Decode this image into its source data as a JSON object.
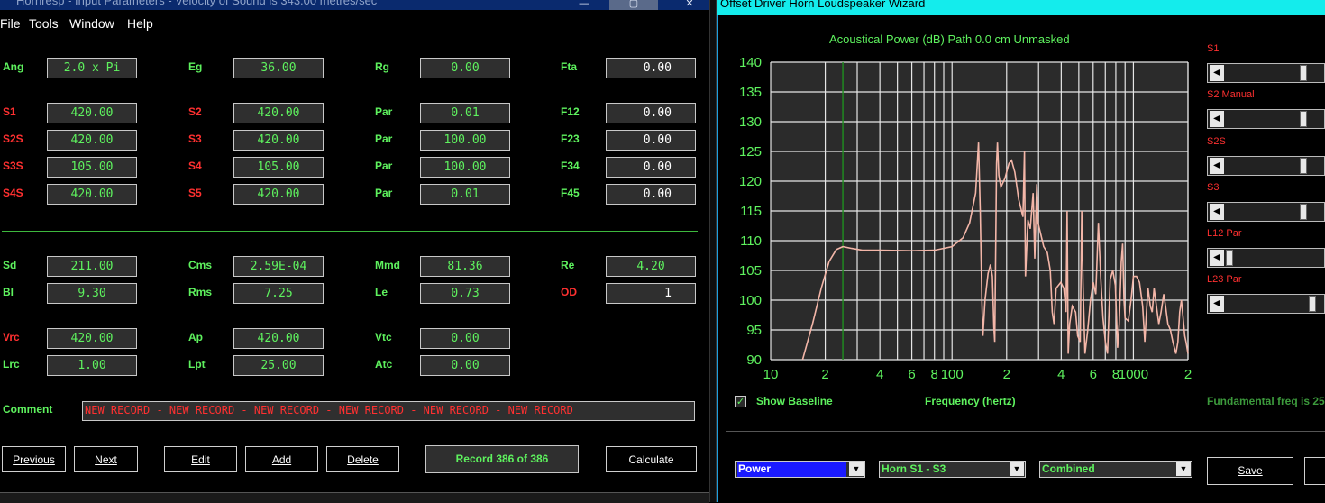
{
  "left_window": {
    "title": "Hornresp - Input Parameters - Velocity of Sound is 343.00 metres/sec",
    "controls": [
      "—",
      "▢",
      "✕"
    ],
    "menu": [
      "File",
      "Tools",
      "Window",
      "Help"
    ],
    "params": [
      {
        "key": "ang",
        "label": "Ang",
        "value": "2.0 x Pi",
        "red": false
      },
      {
        "key": "eg",
        "label": "Eg",
        "value": "36.00",
        "red": false
      },
      {
        "key": "rg",
        "label": "Rg",
        "value": "0.00",
        "red": false
      },
      {
        "key": "fta",
        "label": "Fta",
        "value": "0.00",
        "red": false,
        "white": true
      },
      {
        "key": "s1",
        "label": "S1",
        "value": "420.00",
        "red": true
      },
      {
        "key": "s2",
        "label": "S2",
        "value": "420.00",
        "red": true
      },
      {
        "key": "par1",
        "label": "Par",
        "value": "0.01",
        "red": false
      },
      {
        "key": "f12",
        "label": "F12",
        "value": "0.00",
        "red": false,
        "white": true
      },
      {
        "key": "s2s",
        "label": "S2S",
        "value": "420.00",
        "red": true
      },
      {
        "key": "s3",
        "label": "S3",
        "value": "420.00",
        "red": true
      },
      {
        "key": "par2",
        "label": "Par",
        "value": "100.00",
        "red": false
      },
      {
        "key": "f23",
        "label": "F23",
        "value": "0.00",
        "red": false,
        "white": true
      },
      {
        "key": "s3s",
        "label": "S3S",
        "value": "105.00",
        "red": true
      },
      {
        "key": "s4",
        "label": "S4",
        "value": "105.00",
        "red": true
      },
      {
        "key": "par3",
        "label": "Par",
        "value": "100.00",
        "red": false
      },
      {
        "key": "f34",
        "label": "F34",
        "value": "0.00",
        "red": false,
        "white": true
      },
      {
        "key": "s4s",
        "label": "S4S",
        "value": "420.00",
        "red": true
      },
      {
        "key": "s5",
        "label": "S5",
        "value": "420.00",
        "red": true
      },
      {
        "key": "par4",
        "label": "Par",
        "value": "0.01",
        "red": false
      },
      {
        "key": "f45",
        "label": "F45",
        "value": "0.00",
        "red": false,
        "white": true
      },
      {
        "key": "sd",
        "label": "Sd",
        "value": "211.00",
        "red": false
      },
      {
        "key": "cms",
        "label": "Cms",
        "value": "2.59E-04",
        "red": false
      },
      {
        "key": "mmd",
        "label": "Mmd",
        "value": "81.36",
        "red": false
      },
      {
        "key": "re",
        "label": "Re",
        "value": "4.20",
        "red": false
      },
      {
        "key": "bl",
        "label": "Bl",
        "value": "9.30",
        "red": false
      },
      {
        "key": "rms",
        "label": "Rms",
        "value": "7.25",
        "red": false
      },
      {
        "key": "le",
        "label": "Le",
        "value": "0.73",
        "red": false
      },
      {
        "key": "od",
        "label": "OD",
        "value": "1",
        "red": true,
        "white": true
      },
      {
        "key": "vrc",
        "label": "Vrc",
        "value": "420.00",
        "red": true
      },
      {
        "key": "ap",
        "label": "Ap",
        "value": "420.00",
        "red": false
      },
      {
        "key": "vtc",
        "label": "Vtc",
        "value": "0.00",
        "red": false
      },
      {
        "key": "lrc",
        "label": "Lrc",
        "value": "1.00",
        "red": false
      },
      {
        "key": "lpt",
        "label": "Lpt",
        "value": "25.00",
        "red": false
      },
      {
        "key": "atc",
        "label": "Atc",
        "value": "0.00",
        "red": false
      }
    ],
    "comment_label": "Comment",
    "comment_value": "NEW RECORD - NEW RECORD - NEW RECORD - NEW RECORD - NEW RECORD - NEW RECORD",
    "buttons": {
      "previous": "Previous",
      "next": "Next",
      "edit": "Edit",
      "add": "Add",
      "delete": "Delete",
      "calculate": "Calculate"
    },
    "record": "Record 386 of 386"
  },
  "right_window": {
    "title": "Offset Driver Horn Loudspeaker Wizard",
    "sliders": [
      {
        "label": "S1",
        "position": 0.82
      },
      {
        "label": "S2 Manual",
        "position": 0.82
      },
      {
        "label": "S2S",
        "position": 0.82
      },
      {
        "label": "S3",
        "position": 0.82
      },
      {
        "label": "L12 Par",
        "position": 0.0
      },
      {
        "label": "L23 Par",
        "position": 0.92
      }
    ],
    "show_baseline": "Show Baseline",
    "show_baseline_checked": true,
    "fundamental": "Fundamental freq is 25",
    "combos": {
      "view": "Power",
      "segment": "Horn S1 - S3",
      "mode": "Combined"
    },
    "save": "Save"
  },
  "chart_data": {
    "type": "line",
    "title": "Acoustical Power (dB)   Path 0.0 cm   Unmasked",
    "xlabel": "Frequency (hertz)",
    "ylabel": "",
    "x_scale": "log",
    "xlim": [
      10,
      2000
    ],
    "ylim": [
      90,
      140
    ],
    "y_ticks": [
      140,
      135,
      130,
      125,
      120,
      115,
      110,
      105,
      100,
      95,
      90
    ],
    "x_ticks": [
      {
        "v": 10,
        "t": "10"
      },
      {
        "v": 20,
        "t": "2"
      },
      {
        "v": 40,
        "t": "4"
      },
      {
        "v": 60,
        "t": "6"
      },
      {
        "v": 80,
        "t": "8"
      },
      {
        "v": 100,
        "t": "100"
      },
      {
        "v": 200,
        "t": "2"
      },
      {
        "v": 400,
        "t": "4"
      },
      {
        "v": 600,
        "t": "6"
      },
      {
        "v": 800,
        "t": "8"
      },
      {
        "v": 1000,
        "t": "1000"
      },
      {
        "v": 2000,
        "t": "2"
      }
    ],
    "marker_x": 25,
    "grid": true,
    "series": [
      {
        "color": "#f3b6a8",
        "points": [
          [
            15,
            90
          ],
          [
            17,
            96
          ],
          [
            19,
            102
          ],
          [
            21,
            106.5
          ],
          [
            23,
            108.5
          ],
          [
            25,
            109
          ],
          [
            28,
            108.7
          ],
          [
            32,
            108.4
          ],
          [
            40,
            108.4
          ],
          [
            60,
            108.3
          ],
          [
            80,
            108.4
          ],
          [
            100,
            109
          ],
          [
            115,
            110.5
          ],
          [
            125,
            113
          ],
          [
            135,
            118
          ],
          [
            140,
            126.5
          ],
          [
            143,
            115
          ],
          [
            146,
            100
          ],
          [
            148,
            94
          ],
          [
            152,
            100
          ],
          [
            158,
            104.5
          ],
          [
            163,
            106
          ],
          [
            167,
            104
          ],
          [
            170,
            95.5
          ],
          [
            172,
            93
          ],
          [
            176,
            123
          ],
          [
            178,
            126.5
          ],
          [
            181,
            121
          ],
          [
            186,
            119
          ],
          [
            196,
            120.5
          ],
          [
            206,
            123
          ],
          [
            213,
            123.5
          ],
          [
            222,
            121.5
          ],
          [
            233,
            117
          ],
          [
            246,
            114
          ],
          [
            251,
            125
          ],
          [
            254,
            104
          ],
          [
            262,
            113.5
          ],
          [
            270,
            112
          ],
          [
            280,
            118
          ],
          [
            286,
            107
          ],
          [
            293,
            119.5
          ],
          [
            298,
            113
          ],
          [
            309,
            111
          ],
          [
            320,
            109
          ],
          [
            335,
            108
          ],
          [
            348,
            105
          ],
          [
            357,
            98
          ],
          [
            365,
            96
          ],
          [
            375,
            102
          ],
          [
            398,
            103
          ],
          [
            413,
            102
          ],
          [
            425,
            98
          ],
          [
            431,
            115
          ],
          [
            437,
            91
          ],
          [
            445,
            96
          ],
          [
            460,
            99
          ],
          [
            480,
            98
          ],
          [
            493,
            94
          ],
          [
            509,
            93
          ],
          [
            519,
            115
          ],
          [
            527,
            103
          ],
          [
            541,
            91
          ],
          [
            560,
            95
          ],
          [
            580,
            100
          ],
          [
            601,
            103
          ],
          [
            620,
            101
          ],
          [
            641,
            113
          ],
          [
            660,
            104
          ],
          [
            680,
            97
          ],
          [
            700,
            93
          ],
          [
            720,
            91
          ],
          [
            745,
            103.5
          ],
          [
            770,
            105
          ],
          [
            795,
            102.5
          ],
          [
            818,
            92
          ],
          [
            835,
            96
          ],
          [
            858,
            106.5
          ],
          [
            872,
            109.5
          ],
          [
            888,
            100
          ],
          [
            900,
            97
          ],
          [
            938,
            96.5
          ],
          [
            970,
            100
          ],
          [
            1001,
            104
          ],
          [
            1040,
            104
          ],
          [
            1080,
            103
          ],
          [
            1125,
            99
          ],
          [
            1156,
            93
          ],
          [
            1180,
            98
          ],
          [
            1205,
            102
          ],
          [
            1240,
            99
          ],
          [
            1270,
            98
          ],
          [
            1300,
            102
          ],
          [
            1340,
            99
          ],
          [
            1380,
            96
          ],
          [
            1420,
            98
          ],
          [
            1470,
            101
          ],
          [
            1504,
            99
          ],
          [
            1550,
            96
          ],
          [
            1600,
            95
          ],
          [
            1650,
            93
          ],
          [
            1716,
            91
          ],
          [
            1760,
            93
          ],
          [
            1800,
            98
          ],
          [
            1840,
            100
          ],
          [
            1880,
            97
          ],
          [
            1920,
            94
          ],
          [
            1950,
            93
          ],
          [
            2000,
            91
          ]
        ]
      }
    ]
  },
  "colors": {
    "green": "#5ef25e",
    "red": "#ff3030",
    "field_bg": "#2f2f2f",
    "curve": "#f3b6a8",
    "title_cyan": "#14ecec"
  }
}
